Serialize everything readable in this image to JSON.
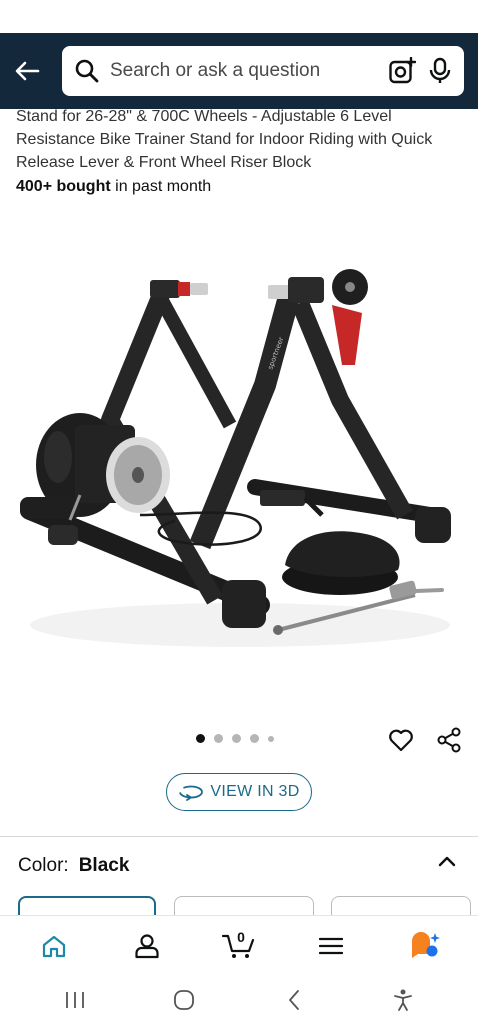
{
  "search": {
    "placeholder": "Search or ask a question"
  },
  "product": {
    "title_fragment": "Stand for 26-28\" & 700C Wheels - Adjustable 6 Level Resistance Bike Trainer Stand for Indoor Riding with Quick Release Lever & Front Wheel Riser Block",
    "bought_bold": "400+ bought",
    "bought_rest": " in past month",
    "image_count": 5,
    "active_image": 1
  },
  "view3d": {
    "label": "VIEW IN 3D"
  },
  "variation": {
    "color_label": "Color:",
    "color_value": "Black"
  },
  "cart": {
    "count": "0"
  },
  "icons": {
    "back": "arrow-left-icon",
    "search": "search-icon",
    "camera": "camera-lens-icon",
    "mic": "microphone-icon",
    "wishlist": "heart-icon",
    "share": "share-icon",
    "view3d": "rotate-3d-icon",
    "collapse": "chevron-up-icon",
    "nav": [
      "home-icon",
      "account-icon",
      "cart-icon",
      "menu-icon",
      "rufus-ai-icon"
    ]
  },
  "colors": {
    "header_bg": "#14283c",
    "accent": "#1b6a8c",
    "home_active": "#1b8aa7",
    "rufus_orange": "#f5811f",
    "rufus_blue": "#1a73e8"
  }
}
